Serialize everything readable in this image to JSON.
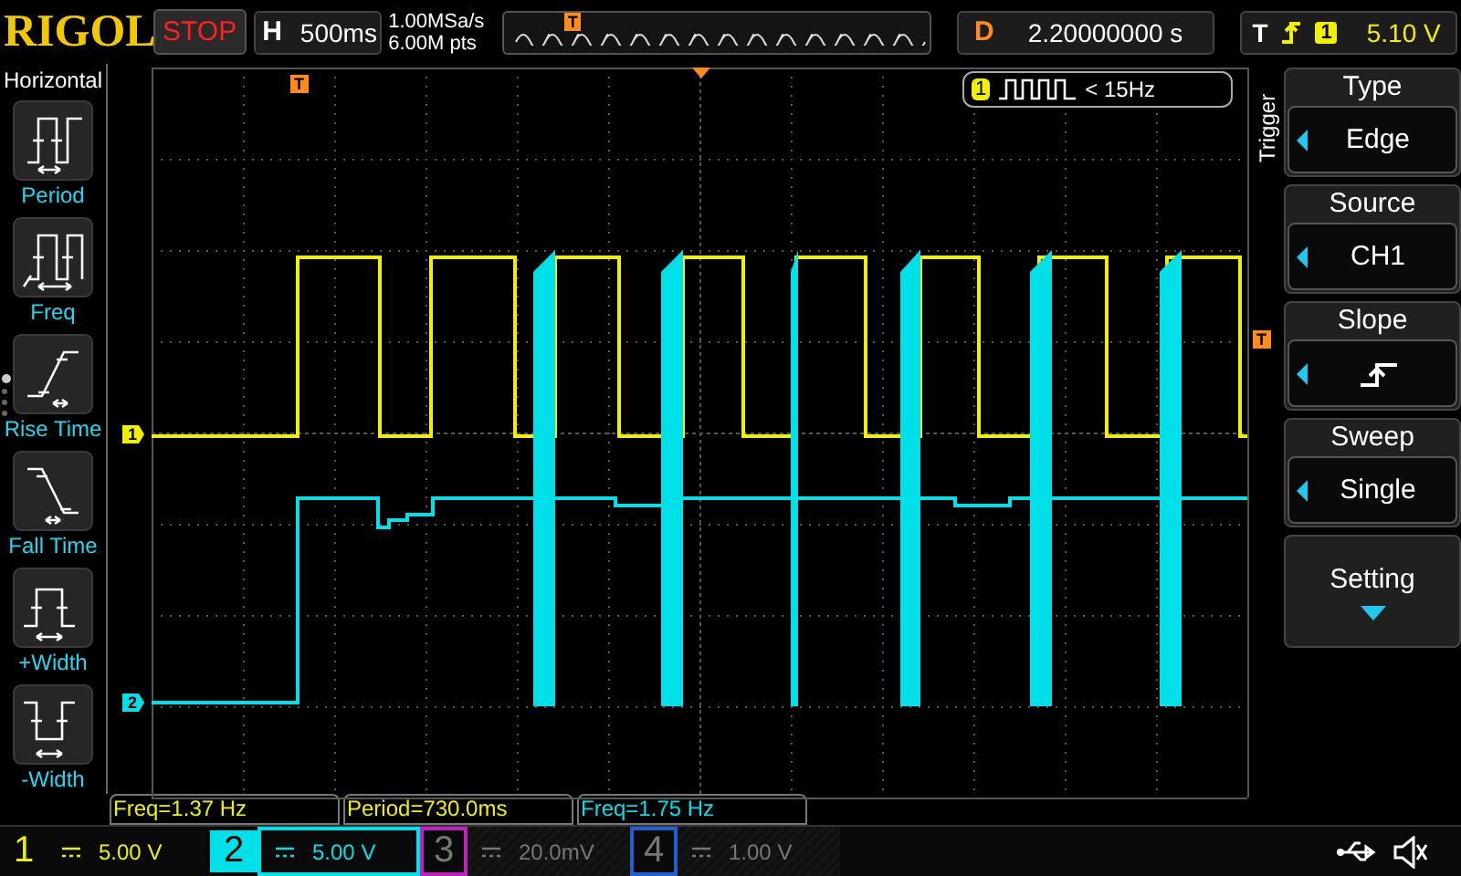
{
  "brand": "RIGOL",
  "run_state": "STOP",
  "timebase": {
    "label": "H",
    "value": "500ms"
  },
  "acquisition": {
    "sample_rate": "1.00MSa/s",
    "memory_depth": "6.00M pts"
  },
  "overview": {
    "marker": "T"
  },
  "delay": {
    "label": "D",
    "value": "2.20000000 s"
  },
  "trigger_status": {
    "label": "T",
    "source": "1",
    "level": "5.10 V"
  },
  "left_menu": {
    "title": "Horizontal",
    "items": [
      {
        "label": "Period",
        "kind": "period"
      },
      {
        "label": "Freq",
        "kind": "freq"
      },
      {
        "label": "Rise Time",
        "kind": "rise"
      },
      {
        "label": "Fall Time",
        "kind": "fall"
      },
      {
        "label": "+Width",
        "kind": "pwidth"
      },
      {
        "label": "-Width",
        "kind": "nwidth"
      }
    ]
  },
  "page_dots": [
    {
      "selected": true
    },
    {
      "selected": false
    },
    {
      "selected": false
    },
    {
      "selected": false
    }
  ],
  "markers": {
    "trigger_position": "T",
    "trigger_level": "T",
    "channel_1": "1",
    "channel_2": "2"
  },
  "counter": {
    "channel": "1",
    "text": "< 15Hz"
  },
  "trigger_menu": {
    "title": "Trigger",
    "items": [
      {
        "label": "Type",
        "kind": "select",
        "value": "Edge"
      },
      {
        "label": "Source",
        "kind": "select",
        "value": "CH1"
      },
      {
        "label": "Slope",
        "kind": "slope"
      },
      {
        "label": "Sweep",
        "kind": "select",
        "value": "Single"
      },
      {
        "label": "Setting",
        "kind": "submenu"
      }
    ]
  },
  "measurements": [
    {
      "text": "Freq=1.37 Hz",
      "color": "#f0f000"
    },
    {
      "text": "Period=730.0ms",
      "color": "#f0f000"
    },
    {
      "text": "Freq=1.75 Hz",
      "color": "#00e0e8"
    }
  ],
  "channels": [
    {
      "number": "1",
      "scale": "5.00 V",
      "on": true,
      "selected": false,
      "color": "#f0f000"
    },
    {
      "number": "2",
      "scale": "5.00 V",
      "on": true,
      "selected": true,
      "color": "#00e0e8"
    },
    {
      "number": "3",
      "scale": "20.0mV",
      "on": false,
      "selected": false,
      "color": "#c020c0"
    },
    {
      "number": "4",
      "scale": "1.00 V",
      "on": false,
      "selected": false,
      "color": "#2060d0"
    }
  ]
}
